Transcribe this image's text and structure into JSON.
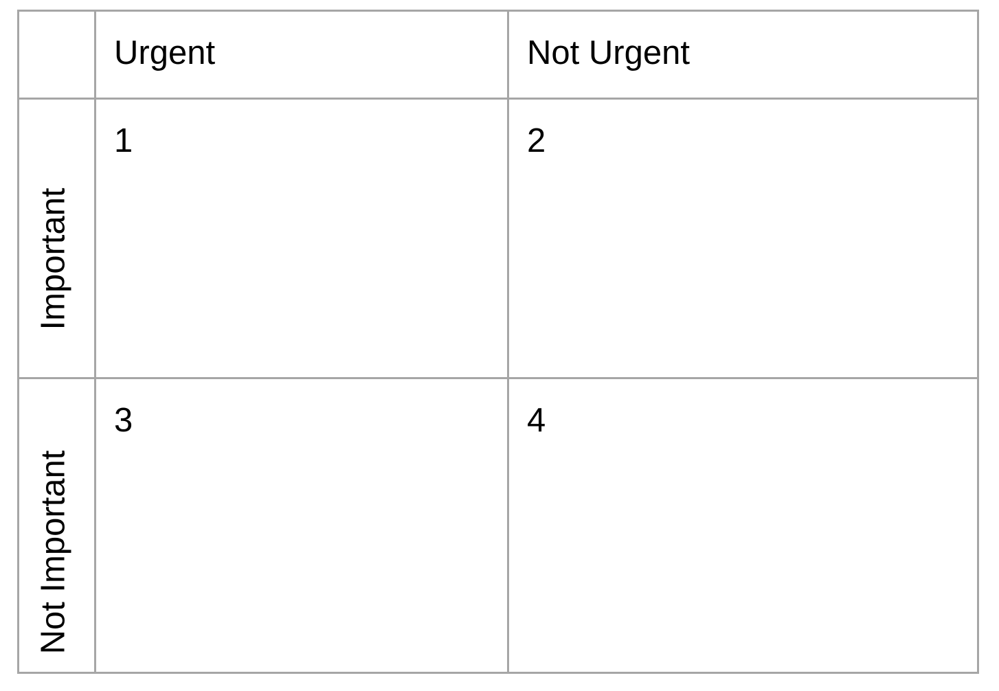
{
  "matrix": {
    "columns": [
      "Urgent",
      "Not Urgent"
    ],
    "rows": [
      "Important",
      "Not Important"
    ],
    "quadrants": [
      "1",
      "2",
      "3",
      "4"
    ],
    "border_color": "#a6a6a6",
    "text_color": "#000000"
  }
}
